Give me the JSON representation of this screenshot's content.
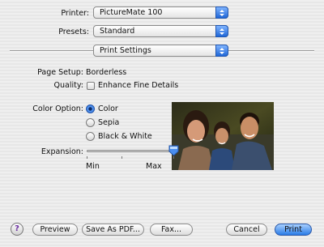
{
  "printer": {
    "label": "Printer:",
    "value": "PictureMate 100"
  },
  "presets": {
    "label": "Presets:",
    "value": "Standard"
  },
  "panel": {
    "value": "Print Settings"
  },
  "page_setup": {
    "label": "Page Setup:",
    "value": "Borderless"
  },
  "quality": {
    "label": "Quality:",
    "checkbox_label": "Enhance Fine Details",
    "checked": false
  },
  "color_option": {
    "label": "Color Option:",
    "options": [
      "Color",
      "Sepia",
      "Black & White"
    ],
    "selected": "Color"
  },
  "expansion": {
    "label": "Expansion:",
    "min_label": "Min",
    "max_label": "Max",
    "value_fraction": 1.0
  },
  "buttons": {
    "help": "?",
    "preview": "Preview",
    "save_pdf": "Save As PDF...",
    "fax": "Fax...",
    "cancel": "Cancel",
    "print": "Print"
  },
  "colors": {
    "accent": "#2a7be6"
  }
}
